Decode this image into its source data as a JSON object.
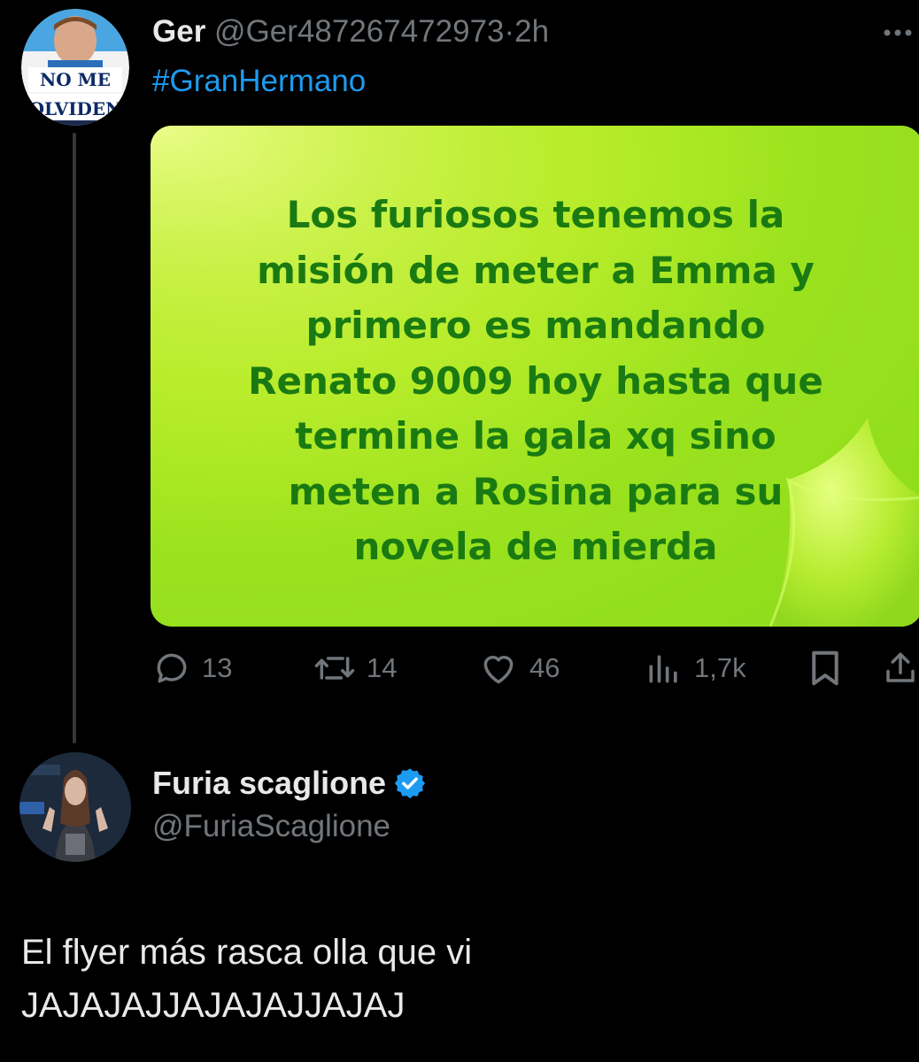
{
  "tweet": {
    "author_name": "Ger",
    "author_handle": "@Ger487267472973",
    "separator": "·",
    "time_ago": "2h",
    "hashtag": "#GranHermano",
    "avatar_caption_line1": "NO ME",
    "avatar_caption_line2": "OLVIDEN",
    "flyer_text": "Los furiosos tenemos la\nmisión de meter a Emma y\nprimero es mandando\nRenato 9009 hoy hasta que\ntermine la gala xq sino\nmeten a Rosina para su\nnovela de mierda",
    "stats": {
      "replies": "13",
      "retweets": "14",
      "likes": "46",
      "views": "1,7k"
    }
  },
  "reply": {
    "author_name": "Furia scaglione",
    "author_handle": "@FuriaScaglione",
    "verified": true,
    "text": "El flyer más rasca olla que vi\nJAJAJAJJAJAJAJJAJAJ"
  },
  "colors": {
    "background": "#000000",
    "text": "#e7e9ea",
    "muted": "#71767b",
    "link": "#1d9bf0",
    "flyer_bg": "#a6e622",
    "flyer_text": "#1a7a12"
  }
}
